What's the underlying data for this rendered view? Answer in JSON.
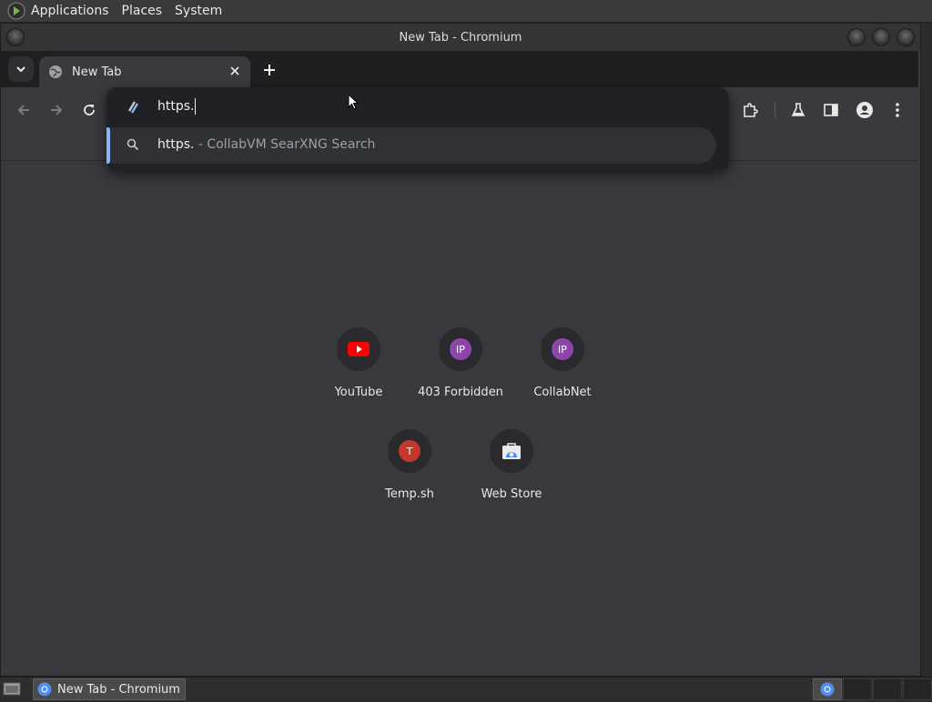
{
  "top_panel": {
    "menus": [
      "Applications",
      "Places",
      "System"
    ]
  },
  "window": {
    "title": "New Tab - Chromium"
  },
  "tabs": [
    {
      "label": "New Tab"
    }
  ],
  "omnibox": {
    "input_value": "https.",
    "suggestion": {
      "query": "https.",
      "source": " - CollabVM SearXNG Search"
    }
  },
  "shortcuts": [
    {
      "label": "YouTube",
      "icon": "youtube-icon"
    },
    {
      "label": "403 Forbidden",
      "letter": "IP",
      "color": "#8e44ad"
    },
    {
      "label": "CollabNet",
      "letter": "IP",
      "color": "#8e44ad"
    },
    {
      "label": "Temp.sh",
      "letter": "T",
      "color": "#c0392b"
    },
    {
      "label": "Web Store",
      "icon": "web-store-icon"
    }
  ],
  "taskbar": {
    "task_label": "New Tab - Chromium"
  },
  "colors": {
    "accent": "#8ab4f8",
    "youtube": "#ff0000",
    "letter_ip": "#8e44ad",
    "letter_t": "#c0392b"
  }
}
